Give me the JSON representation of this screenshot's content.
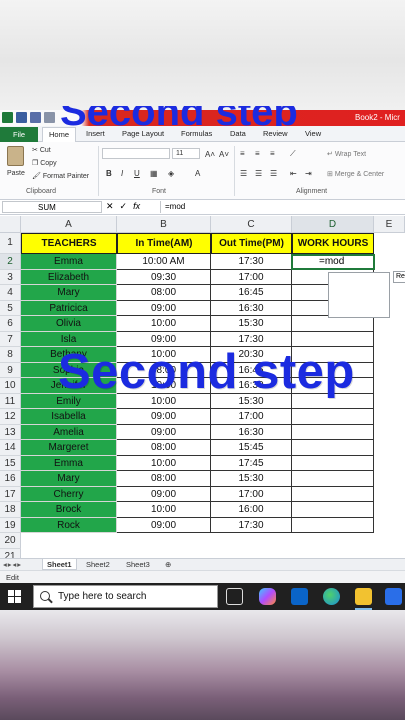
{
  "titlebar": {
    "window_title": "Book2 - Micr"
  },
  "tabs": {
    "file": "File",
    "items": [
      "Home",
      "Insert",
      "Page Layout",
      "Formulas",
      "Data",
      "Review",
      "View"
    ]
  },
  "ribbon": {
    "paste": "Paste",
    "cut": "Cut",
    "copy": "Copy",
    "format_painter": "Format Painter",
    "clipboard": "Clipboard",
    "font_size": "11",
    "font": "Font",
    "wrap_text": "Wrap Text",
    "merge_center": "Merge & Center",
    "alignment": "Alignment"
  },
  "formula_bar": {
    "name_box": "SUM",
    "formula": "=mod"
  },
  "columns": [
    "A",
    "B",
    "C",
    "D",
    "E"
  ],
  "rows": [
    "1",
    "2",
    "3",
    "4",
    "5",
    "6",
    "7",
    "8",
    "9",
    "10",
    "11",
    "12",
    "13",
    "14",
    "15",
    "16",
    "17",
    "18",
    "19",
    "20",
    "21"
  ],
  "headers": {
    "teachers": "TEACHERS",
    "in_time": "In Time(AM)",
    "out_time": "Out Time(PM)",
    "work_hours": "WORK HOURS"
  },
  "table": [
    {
      "teacher": "Emma",
      "in": "10:00 AM",
      "out": "17:30"
    },
    {
      "teacher": "Elizabeth",
      "in": "09:30",
      "out": "17:00"
    },
    {
      "teacher": "Mary",
      "in": "08:00",
      "out": "16:45"
    },
    {
      "teacher": "Patricica",
      "in": "09:00",
      "out": "16:30"
    },
    {
      "teacher": "Olivia",
      "in": "10:00",
      "out": "15:30"
    },
    {
      "teacher": "Isla",
      "in": "09:00",
      "out": "17:30"
    },
    {
      "teacher": "Bethany",
      "in": "10:00",
      "out": "20:30"
    },
    {
      "teacher": "Sophia",
      "in": "08:00",
      "out": "16:45"
    },
    {
      "teacher": "Jennifer",
      "in": "10:00",
      "out": "16:30"
    },
    {
      "teacher": "Emily",
      "in": "10:00",
      "out": "15:30"
    },
    {
      "teacher": "Isabella",
      "in": "09:00",
      "out": "17:00"
    },
    {
      "teacher": "Amelia",
      "in": "09:00",
      "out": "16:30"
    },
    {
      "teacher": "Margeret",
      "in": "08:00",
      "out": "15:45"
    },
    {
      "teacher": "Emma",
      "in": "10:00",
      "out": "17:45"
    },
    {
      "teacher": "Mary",
      "in": "08:00",
      "out": "15:30"
    },
    {
      "teacher": "Cherry",
      "in": "09:00",
      "out": "17:00"
    },
    {
      "teacher": "Brock",
      "in": "10:00",
      "out": "16:00"
    },
    {
      "teacher": "Rock",
      "in": "09:00",
      "out": "17:30"
    }
  ],
  "active_cell_value": "=mod",
  "tooltip_text": "Re",
  "overlay_text": "Second step",
  "sheet_tabs": [
    "Sheet1",
    "Sheet2",
    "Sheet3"
  ],
  "status": "Edit",
  "taskbar": {
    "search_placeholder": "Type here to search"
  },
  "colors": {
    "header_yellow": "#ffff00",
    "teacher_green": "#22a64a",
    "overlay_blue": "#1b2be0",
    "file_green": "#1f7a3a"
  }
}
